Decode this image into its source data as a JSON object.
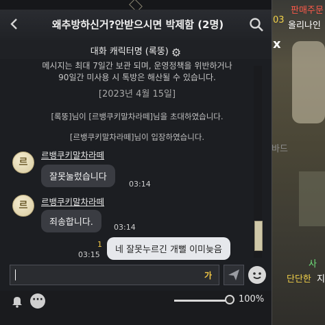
{
  "header": {
    "title": "왜추방하신거?안받으시면 박제함 (2명)",
    "subtitle": "대화 캐릭터명 (록뚱)"
  },
  "notice": {
    "line1": "메시지는 최대 7일간 보관 되며, 운영정책을 위반하거나",
    "line2": "90일간 미사용 시 톡방은 해산될 수 있습니다."
  },
  "date_separator": "[2023년 4월 15일]",
  "system_messages": [
    "[록뚱]님이 [르뱅쿠키말차라떼]님을 초대하였습니다.",
    "[르뱅쿠키말차라떼]님이 입장하였습니다."
  ],
  "messages": [
    {
      "avatar": "르",
      "sender": "르뱅쿠키말차라떼",
      "text": "잘못눌렀습니다",
      "time": "03:14"
    },
    {
      "avatar": "르",
      "sender": "르뱅쿠키말차라떼",
      "text": "죄송합니다.",
      "time": "03:14"
    },
    {
      "unread": "1",
      "text": "네 잘못누르긴 개뻘 이미늦음",
      "time": "03:15"
    }
  ],
  "input": {
    "value": "",
    "ime_mode": "가"
  },
  "footer": {
    "zoom_label": "100%",
    "zoom_level_fraction": 1.0
  },
  "game_overlay": {
    "texts": [
      "판매주문",
      "03",
      "올리나인",
      "x",
      "바드",
      "사",
      "단단한",
      "지"
    ]
  },
  "colors": {
    "accent_yellow": "#f3c845",
    "window_bg": "#1c1e22",
    "bubble_other": "#3a3c42",
    "bubble_mine": "#e6e8ec"
  },
  "icons": [
    "back-icon",
    "search-icon",
    "gear-icon",
    "send-icon",
    "emoji-icon",
    "bell-icon",
    "more-icon"
  ]
}
